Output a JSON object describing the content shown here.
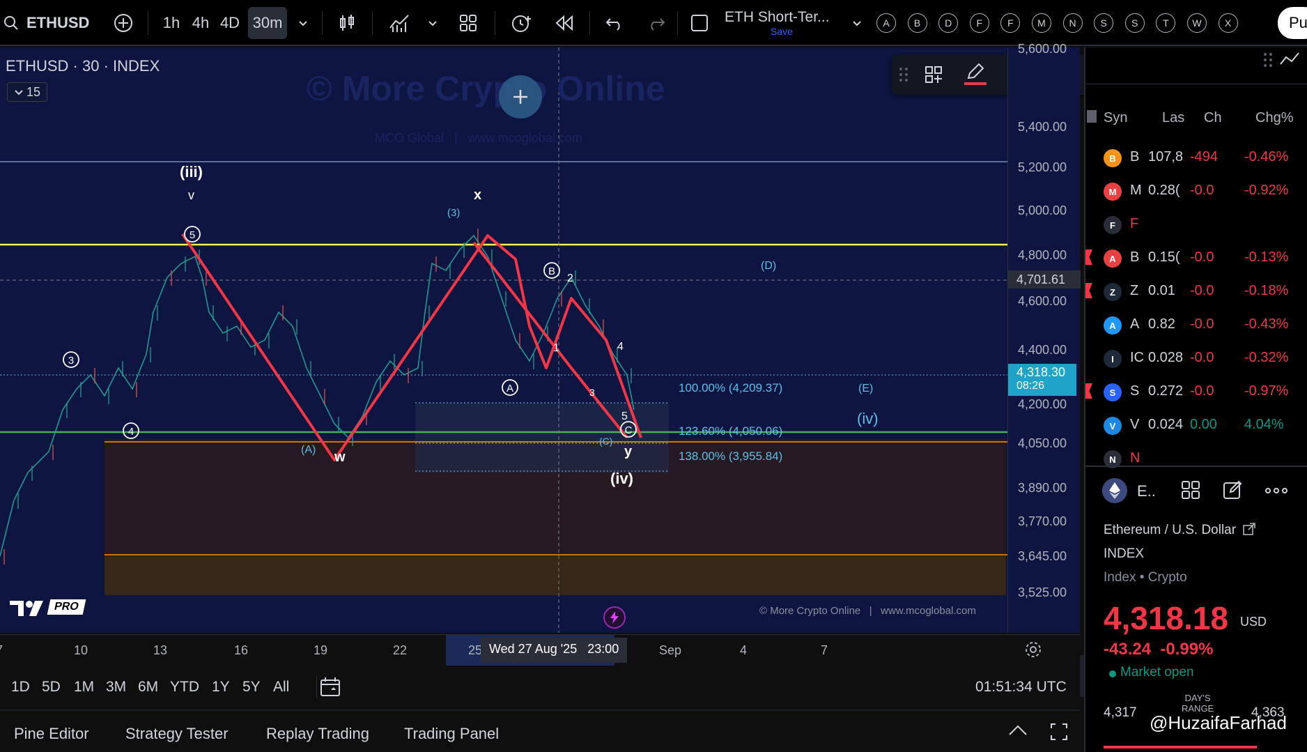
{
  "toolbar": {
    "symbol": "ETHUSD",
    "intervals": [
      "1h",
      "4h",
      "4D",
      "30m"
    ],
    "active_interval": "30m",
    "layout_name": "ETH Short-Ter...",
    "save_label": "Save",
    "alert_letters": [
      "A",
      "B",
      "D",
      "F",
      "F",
      "M",
      "N",
      "S",
      "S",
      "T",
      "W",
      "X"
    ],
    "publish_label": "Pu"
  },
  "chart": {
    "legend_title": "ETHUSD · 30 · INDEX",
    "legend_collapse": "15",
    "watermark_title": "© More Crypto Online",
    "watermark_sub": "MCO Global   |   www.mcoglobal.com",
    "footer_watermark": "© More Crypto Online   |   www.mcoglobal.com",
    "logo_badge": "PRO",
    "fib_levels": [
      "100.00% (4,209.37)",
      "123.60% (4,050.06)",
      "138.00% (3,955.84)"
    ],
    "wave_labels": {
      "iii": "(iii)",
      "v_small": "v",
      "five_circled": "5",
      "three_circled": "3",
      "four_circled": "4",
      "A_paren": "(A)",
      "w": "w",
      "x": "x",
      "three_paren": "(3)",
      "B_circled": "B",
      "two": "2",
      "one": "1",
      "four": "4",
      "three": "3",
      "A_circled": "A",
      "five": "5",
      "C_circled": "C",
      "C_paren": "(C)",
      "y": "y",
      "iv": "(iv)",
      "D_paren": "(D)",
      "E_paren": "(E)",
      "iv_blue": "(iv)"
    },
    "crosshair_price": "4,701.61",
    "last_price": "4,318.30",
    "countdown": "08:26",
    "price_ticks": [
      "5,600.00",
      "5,400.00",
      "5,200.00",
      "5,000.00",
      "4,800.00",
      "4,600.00",
      "4,400.00",
      "4,200.00",
      "4,050.00",
      "3,890.00",
      "3,770.00",
      "3,645.00",
      "3,525.00"
    ],
    "time_ticks": [
      "7",
      "10",
      "13",
      "16",
      "19",
      "22",
      "25",
      "Sep",
      "4",
      "7"
    ],
    "crosshair_time": "Wed 27 Aug '25   23:00",
    "colors": {
      "candle_up": "#26a69a",
      "candle_down": "#ef5350",
      "wave_line": "#f23645",
      "yellow_line": "#fff44f",
      "green_line": "#4caf50",
      "orange_line": "#ff9800",
      "blue_label": "#5bc0eb",
      "last_price_bg": "#1fa3c9"
    }
  },
  "ranges": [
    "1D",
    "5D",
    "1M",
    "3M",
    "6M",
    "YTD",
    "1Y",
    "5Y",
    "All"
  ],
  "clock": "01:51:34 UTC",
  "bottom_tabs": [
    "Pine Editor",
    "Strategy Tester",
    "Replay Trading",
    "Trading Panel"
  ],
  "drawing_toolbar": {
    "width_label": "3px"
  },
  "watchlist": {
    "headers": [
      "Syn",
      "Las",
      "Ch",
      "Chg%"
    ],
    "rows": [
      {
        "icon": "B",
        "color": "#f7931a",
        "sym": "B",
        "last": "107,8",
        "chg": "-494",
        "pct": "-0.46%",
        "flag": false,
        "dir": "neg"
      },
      {
        "icon": "M",
        "color": "#e84142",
        "sym": "M",
        "last": "0.28(",
        "chg": "-0.0",
        "pct": "-0.92%",
        "flag": false,
        "dir": "neg"
      },
      {
        "icon": "F",
        "color": "#2a2e39",
        "sym": "F",
        "last": "",
        "chg": "",
        "pct": "",
        "flag": false,
        "dir": "neg"
      },
      {
        "icon": "A",
        "color": "#e84142",
        "sym": "B",
        "last": "0.15(",
        "chg": "-0.0",
        "pct": "-0.13%",
        "flag": true,
        "dir": "neg"
      },
      {
        "icon": "Z",
        "color": "#1e2a3a",
        "sym": "Z",
        "last": "0.01",
        "chg": "-0.0",
        "pct": "-0.18%",
        "flag": true,
        "dir": "neg"
      },
      {
        "icon": "A",
        "color": "#2196f3",
        "sym": "A",
        "last": "0.82",
        "chg": "-0.0",
        "pct": "-0.43%",
        "flag": false,
        "dir": "neg"
      },
      {
        "icon": "I",
        "color": "#1e2a3a",
        "sym": "IC",
        "last": "0.028",
        "chg": "-0.0",
        "pct": "-0.32%",
        "flag": false,
        "dir": "neg"
      },
      {
        "icon": "S",
        "color": "#2962ff",
        "sym": "S",
        "last": "0.272",
        "chg": "-0.0",
        "pct": "-0.97%",
        "flag": true,
        "dir": "neg"
      },
      {
        "icon": "V",
        "color": "#1e88e5",
        "sym": "V",
        "last": "0.024",
        "chg": "0.00",
        "pct": "4.04%",
        "flag": false,
        "dir": "pos"
      },
      {
        "icon": "N",
        "color": "#2a2e39",
        "sym": "N",
        "last": "",
        "chg": "",
        "pct": "",
        "flag": false,
        "dir": "neg"
      }
    ]
  },
  "details": {
    "short_name": "E..",
    "full_name": "Ethereum / U.S. Dollar",
    "exchange": "INDEX",
    "category": "Index • Crypto",
    "price": "4,318.18",
    "currency": "USD",
    "change": "-43.24  -0.99%",
    "market_status": "Market open",
    "low": "4,317",
    "days_range_label": "DAY'S\nRANGE",
    "high": "4,363",
    "overlay_handle": "@HuzaifaFarhad"
  }
}
